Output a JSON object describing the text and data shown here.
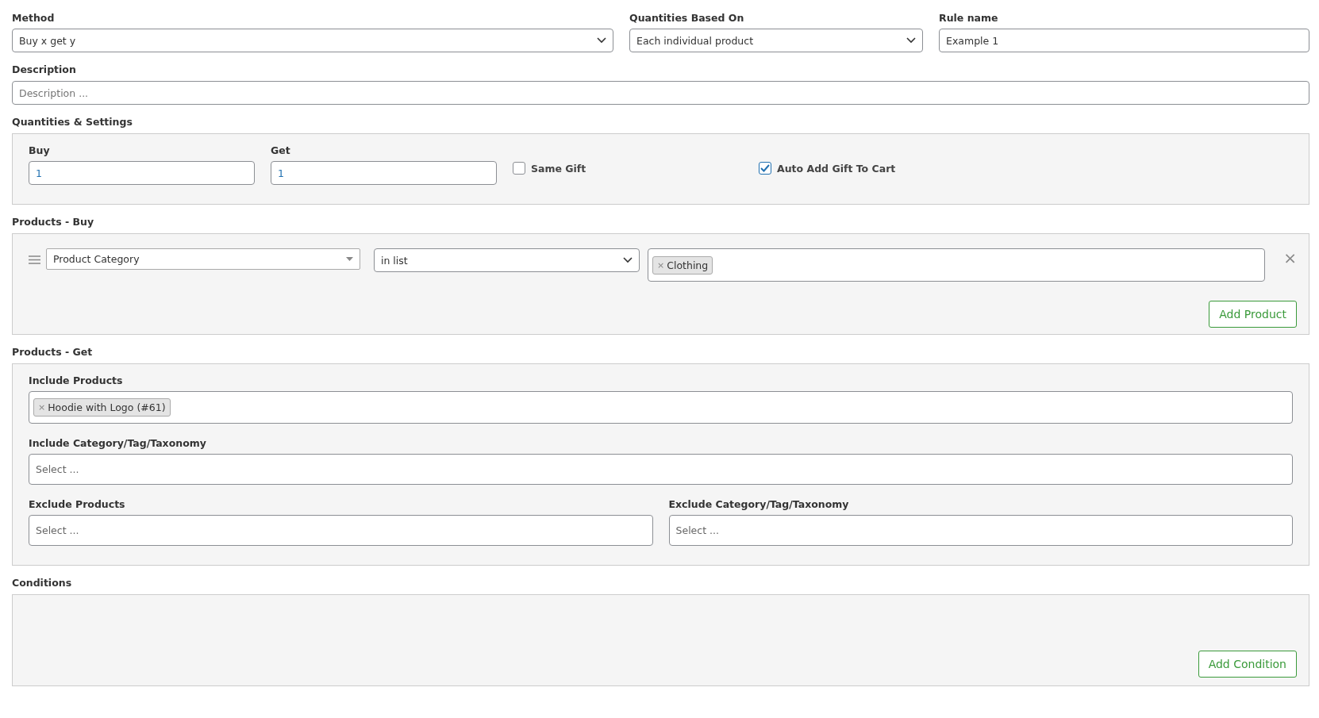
{
  "method": {
    "label": "Method",
    "value": "Buy x get y"
  },
  "quantities_based_on": {
    "label": "Quantities Based On",
    "value": "Each individual product"
  },
  "rule_name": {
    "label": "Rule name",
    "value": "Example 1"
  },
  "description": {
    "label": "Description",
    "placeholder": "Description ..."
  },
  "quantities_settings": {
    "title": "Quantities & Settings",
    "fields": [
      {
        "label": "Buy",
        "value": "1"
      },
      {
        "label": "Get",
        "value": "1"
      }
    ],
    "options": [
      {
        "label": "Same Gift",
        "checked": false
      },
      {
        "label": "Auto Add Gift To Cart",
        "checked": true
      }
    ]
  },
  "products_buy": {
    "title": "Products - Buy",
    "rules": [
      {
        "type": "Product Category",
        "operator": "in list",
        "tags": [
          {
            "remove": "×",
            "label": "Clothing"
          }
        ],
        "remove": "×"
      }
    ],
    "add_button": "Add Product"
  },
  "products_get": {
    "title": "Products - Get",
    "fields": [
      {
        "kind": "full",
        "label": "Include Products",
        "tags": [
          {
            "remove": "×",
            "label": "Hoodie with Logo (#61)"
          }
        ]
      },
      {
        "kind": "full",
        "label": "Include Category/Tag/Taxonomy",
        "placeholder": "Select ..."
      },
      {
        "kind": "half",
        "label": "Exclude Products",
        "placeholder": "Select ..."
      },
      {
        "kind": "half",
        "label": "Exclude Category/Tag/Taxonomy",
        "placeholder": "Select ..."
      }
    ]
  },
  "conditions": {
    "title": "Conditions",
    "add_button": "Add Condition"
  }
}
